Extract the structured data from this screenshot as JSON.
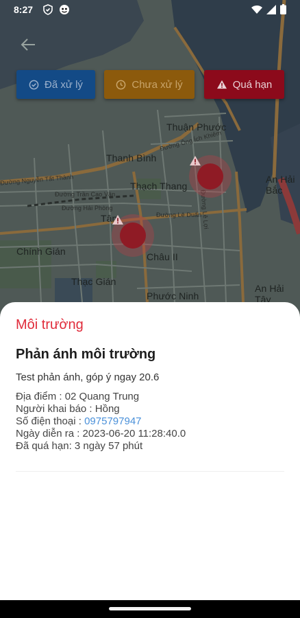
{
  "status_bar": {
    "time": "8:27"
  },
  "filters": {
    "processed": {
      "label": "Đã xử lý",
      "icon": "check-circle-icon"
    },
    "pending": {
      "label": "Chưa xử lý",
      "icon": "clock-icon"
    },
    "overdue": {
      "label": "Quá hạn",
      "icon": "warning-icon"
    }
  },
  "map": {
    "labels": {
      "thuan_phuoc": "Thuận Phước",
      "thanh_binh": "Thanh Bình",
      "thach_thang": "Thạch Thang",
      "tan": "Tân",
      "chinh_gian": "Chính Gián",
      "thac_gian": "Thạc Gián",
      "chau_ii": "Châu II",
      "phuoc_ninh": "Phước Ninh",
      "an_hai_bac": "An Hải Bắc",
      "an_hai_tay": "An Hải Tây",
      "duong_nguyen_tat_thanh": "Đường Nguyễn Tất Thành",
      "duong_tran_cao_van": "Đường Trần Cao Vân",
      "duong_hai_phong": "Đường Hải Phòng",
      "duong_le_duan": "Đường Lê Duẩn",
      "duong_ong_ich_khiem": "Đường Ông Ích Khiêm",
      "duong_le_loi": "Đường Lê Lợi"
    }
  },
  "sheet": {
    "category": "Môi trường",
    "title": "Phản ánh môi trường",
    "description": "Test phản ánh, góp ý ngay 20.6",
    "location": "Địa điểm : 02 Quang Trung",
    "reporter": "Người khai báo : Hồng",
    "phone_label": "Số điện thoại : ",
    "phone_value": "0975797947",
    "date": "Ngày diễn ra : 2023-06-20 11:28:40.0",
    "overdue": "Đã quá hạn: 3 ngày 57 phút"
  }
}
